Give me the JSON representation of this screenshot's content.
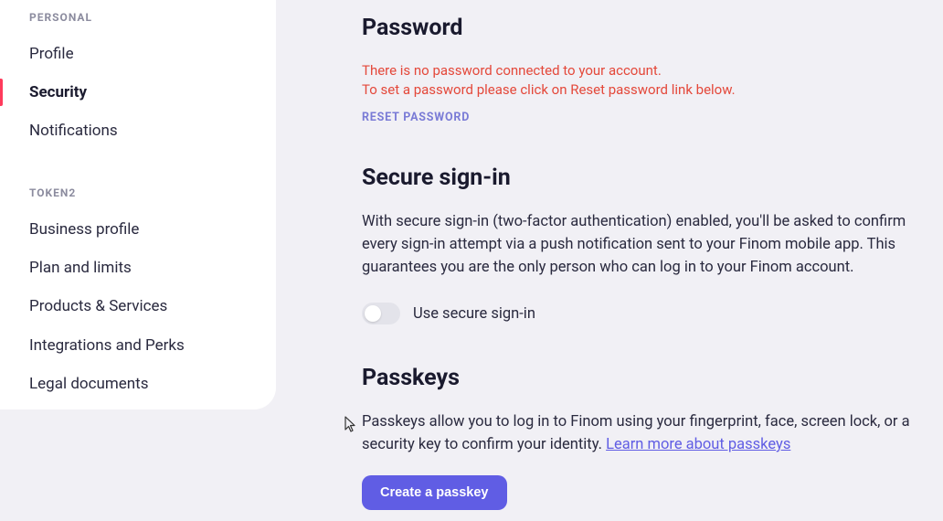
{
  "sidebar": {
    "section1_label": "PERSONAL",
    "items1": [
      {
        "label": "Profile"
      },
      {
        "label": "Security"
      },
      {
        "label": "Notifications"
      }
    ],
    "section2_label": "TOKEN2",
    "items2": [
      {
        "label": "Business profile"
      },
      {
        "label": "Plan and limits"
      },
      {
        "label": "Products & Services"
      },
      {
        "label": "Integrations and Perks"
      },
      {
        "label": "Legal documents"
      }
    ]
  },
  "password": {
    "heading": "Password",
    "warning_line1": "There is no password connected to your account.",
    "warning_line2": "To set a password please click on Reset password link below.",
    "reset_label": "RESET PASSWORD"
  },
  "secure": {
    "heading": "Secure sign-in",
    "desc": "With secure sign-in (two-factor authentication) enabled, you'll be asked to confirm every sign-in attempt via a push notification sent to your Finom mobile app. This guarantees you are the only person who can log in to your Finom account.",
    "toggle_label": "Use secure sign-in"
  },
  "passkeys": {
    "heading": "Passkeys",
    "desc_before": "Passkeys allow you to log in to Finom using your fingerprint, face, screen lock, or a security key to confirm your identity. ",
    "learn_more": "Learn more about passkeys",
    "button_label": "Create a passkey"
  }
}
